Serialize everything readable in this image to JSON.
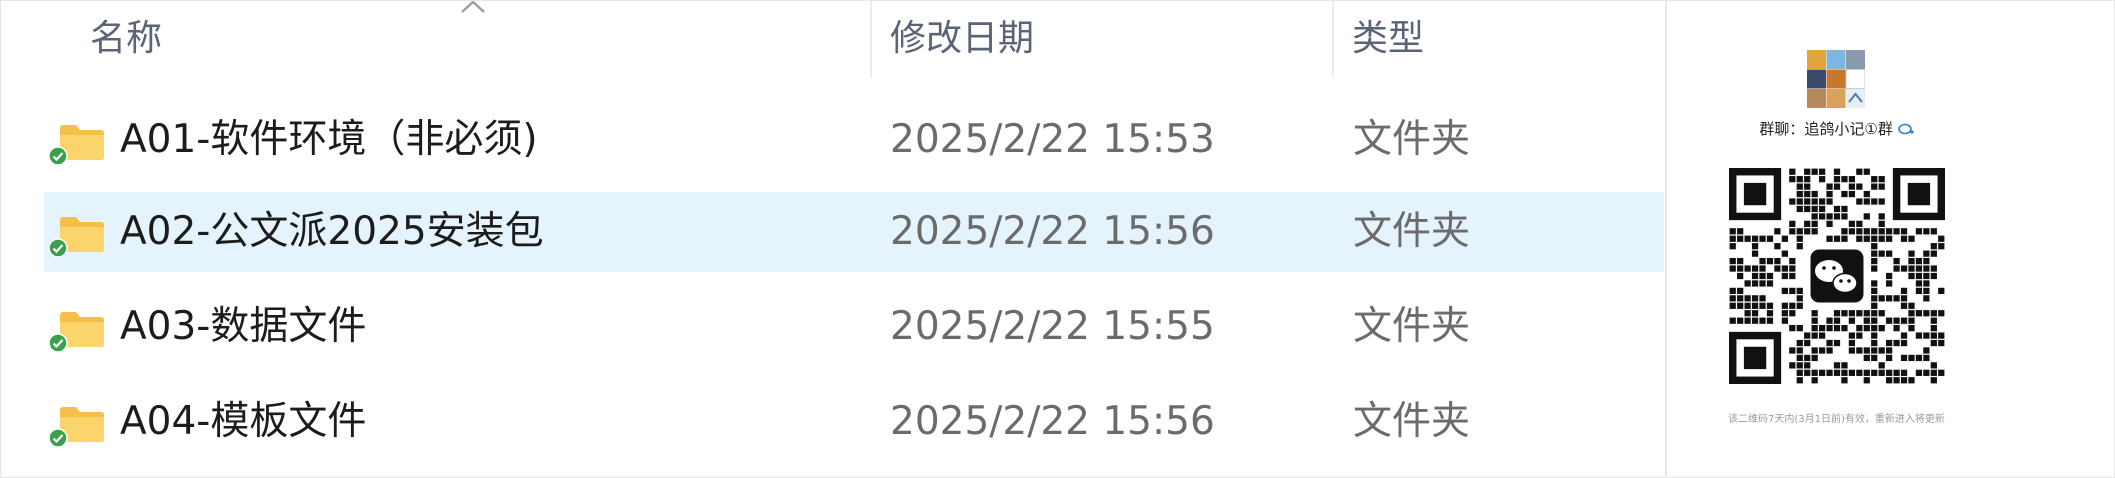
{
  "explorer": {
    "columns": {
      "name": "名称",
      "modified": "修改日期",
      "type": "类型"
    },
    "rows": [
      {
        "name": "A01-软件环境（非必须)",
        "modified": "2025/2/22 15:53",
        "type": "文件夹",
        "selected": false
      },
      {
        "name": "A02-公文派2025安装包",
        "modified": "2025/2/22 15:56",
        "type": "文件夹",
        "selected": true
      },
      {
        "name": "A03-数据文件",
        "modified": "2025/2/22 15:55",
        "type": "文件夹",
        "selected": false
      },
      {
        "name": "A04-模板文件",
        "modified": "2025/2/22 15:56",
        "type": "文件夹",
        "selected": false
      }
    ],
    "colors": {
      "folder": "#f5c04a",
      "sync_ok": "#3aa14a",
      "selected_row": "#e5f3fd"
    }
  },
  "qr_panel": {
    "group_label": "群聊：追鸽小记①群",
    "note": "该二维码7天内(3月1日前)有效，重新进入将更新",
    "center_icon": "wechat-icon",
    "avatar_icon": "group-avatar-icon"
  }
}
